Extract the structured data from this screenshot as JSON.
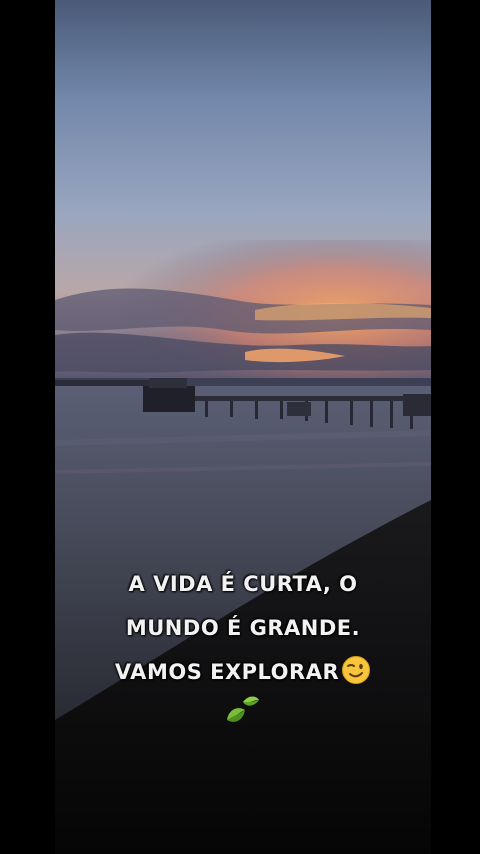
{
  "caption": {
    "line1": "A VIDA É CURTA, O",
    "line2": "MUNDO É GRANDE.",
    "line3": "VAMOS EXPLORAR"
  },
  "icons": {
    "wink": "winking-face-emoji",
    "leaves": "leaves-emoji"
  },
  "colors": {
    "letterbox": "#000000",
    "caption_text": "#f2f2f2",
    "sunset_orange": "#f2a15e",
    "sky_blue": "#7d93b8",
    "water": "#3e4551"
  }
}
